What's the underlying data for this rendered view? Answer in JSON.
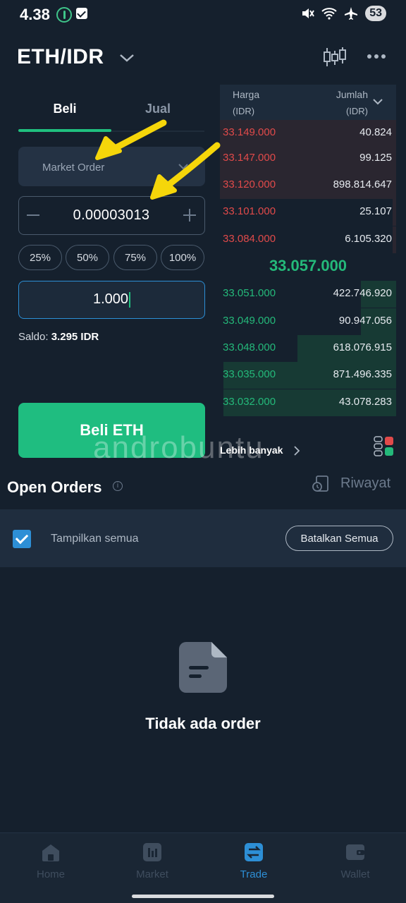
{
  "status_bar": {
    "time": "4.38",
    "battery": "53"
  },
  "header": {
    "pair": "ETH/IDR"
  },
  "tabs": {
    "buy": "Beli",
    "sell": "Jual"
  },
  "order_form": {
    "order_type": "Market Order",
    "amount": "0.00003013",
    "percent_chips": [
      "25%",
      "50%",
      "75%",
      "100%"
    ],
    "total": "1.000",
    "balance_label": "Saldo:",
    "balance_value": "3.295 IDR",
    "buy_button": "Beli ETH"
  },
  "order_book": {
    "price_header": "Harga",
    "price_unit": "(IDR)",
    "amount_header": "Jumlah",
    "amount_unit": "(IDR)",
    "asks": [
      {
        "price": "33.149.000",
        "amount": "40.824",
        "depth": 1.0
      },
      {
        "price": "33.147.000",
        "amount": "99.125",
        "depth": 1.0
      },
      {
        "price": "33.120.000",
        "amount": "898.814.647",
        "depth": 1.0
      },
      {
        "price": "33.101.000",
        "amount": "25.107",
        "depth": 0.02
      },
      {
        "price": "33.084.000",
        "amount": "6.105.320",
        "depth": 0.02
      }
    ],
    "last_price": "33.057.000",
    "bids": [
      {
        "price": "33.051.000",
        "amount": "422.746.920",
        "depth": 0.2
      },
      {
        "price": "33.049.000",
        "amount": "90.947.056",
        "depth": 0.2
      },
      {
        "price": "33.048.000",
        "amount": "618.076.915",
        "depth": 0.56
      },
      {
        "price": "33.035.000",
        "amount": "871.496.335",
        "depth": 0.98
      },
      {
        "price": "33.032.000",
        "amount": "43.078.283",
        "depth": 0.98
      }
    ],
    "more_link": "Lebih banyak"
  },
  "watermark": "androbuntu",
  "open_orders": {
    "title": "Open Orders",
    "history": "Riwayat",
    "show_all": "Tampilkan semua",
    "cancel_all": "Batalkan Semua",
    "empty_text": "Tidak ada order"
  },
  "bottom_nav": {
    "items": [
      {
        "label": "Home"
      },
      {
        "label": "Market"
      },
      {
        "label": "Trade"
      },
      {
        "label": "Wallet"
      }
    ]
  },
  "colors": {
    "background": "#15202d",
    "accent_green": "#1fbd80",
    "ask_red": "#e04a4a",
    "bid_green": "#24b97a",
    "accent_blue": "#2d8fd6",
    "annotation_yellow": "#f5d60a"
  }
}
